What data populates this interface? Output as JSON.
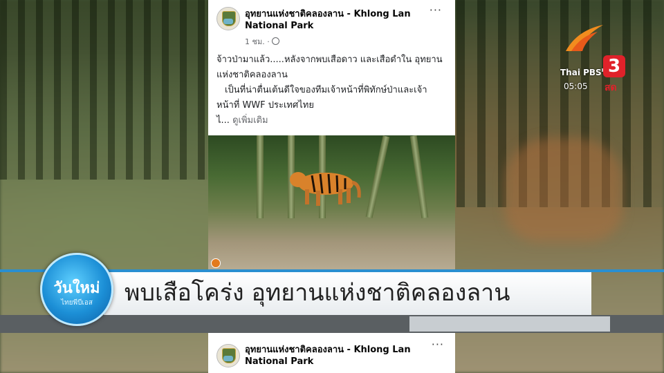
{
  "post": {
    "page_name": "อุทยานแห่งชาติคลองลาน - Khlong Lan National Park",
    "time": "1 ชม. ·",
    "more": "···",
    "text_lines": [
      "จ้าวป่ามาแล้ว.....หลังจากพบเสือดาว และเสือดำใน อุทยานแห่งชาติคลองลาน",
      "เป็นที่น่าตื่นเต้นดีใจของทีมเจ้าหน้าที่พิทักษ์ป่าและเจ้าหน้าที่ WWF ประเทศไทย"
    ],
    "truncated": "ไ...",
    "see_more": "ดูเพิ่มเติม"
  },
  "broadcaster": {
    "brand": "Thai PBS",
    "hd": "HD",
    "channel": "3",
    "live": "สด",
    "clock": "05:05",
    "colors": {
      "red": "#e0222a",
      "orange": "#f28c1e"
    }
  },
  "lower_third": {
    "headline": "พบเสือโคร่ง อุทยานแห่งชาติคลองลาน",
    "show_title": "วันใหม่",
    "show_subtitle": "ไทยพีบีเอส",
    "colors": {
      "accent": "#2a8fd0"
    }
  }
}
